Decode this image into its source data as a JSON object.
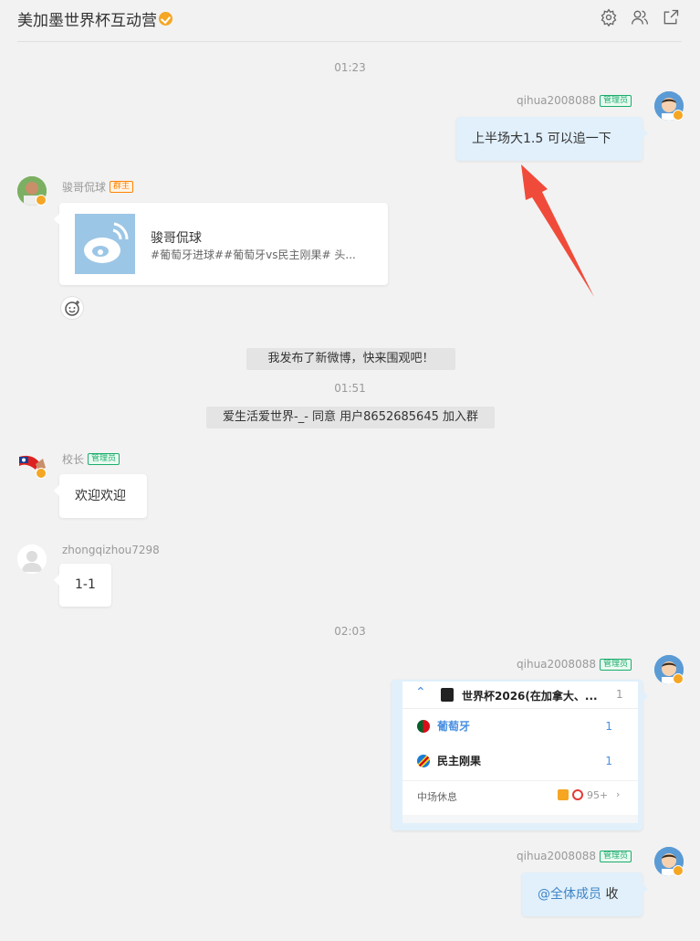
{
  "header": {
    "title": "美加墨世界杯互动营",
    "icons": [
      "gear-icon",
      "members-icon",
      "open-external-icon"
    ]
  },
  "messages": {
    "time1": "01:23",
    "time2": "01:51",
    "time3": "02:03",
    "m1": {
      "sender": "qihua2008088",
      "role": "管理员",
      "text": "上半场大1.5 可以追一下"
    },
    "m2": {
      "sender": "骏哥侃球",
      "role": "群主",
      "card_title": "骏哥侃球",
      "card_desc": "#葡萄牙进球##葡萄牙vs民主刚果# 头..."
    },
    "sys1": "我发布了新微博，快来围观吧！",
    "sys2": "爱生活爱世界-_- 同意 用户8652685645 加入群",
    "m3": {
      "sender": "校长",
      "role": "管理员",
      "text": "欢迎欢迎"
    },
    "m4": {
      "sender": "zhongqizhou7298",
      "text": "1-1"
    },
    "m5": {
      "sender": "qihua2008088",
      "role": "管理员",
      "league": "世界杯2026(在加拿大、...",
      "league_count": "1",
      "team1": "葡萄牙",
      "score1": "1",
      "team2": "民主刚果",
      "score2": "1",
      "status": "中场休息",
      "comments": "95+"
    },
    "m6": {
      "sender": "qihua2008088",
      "role": "管理员",
      "mention": "@全体成员",
      "text": " 收"
    }
  }
}
